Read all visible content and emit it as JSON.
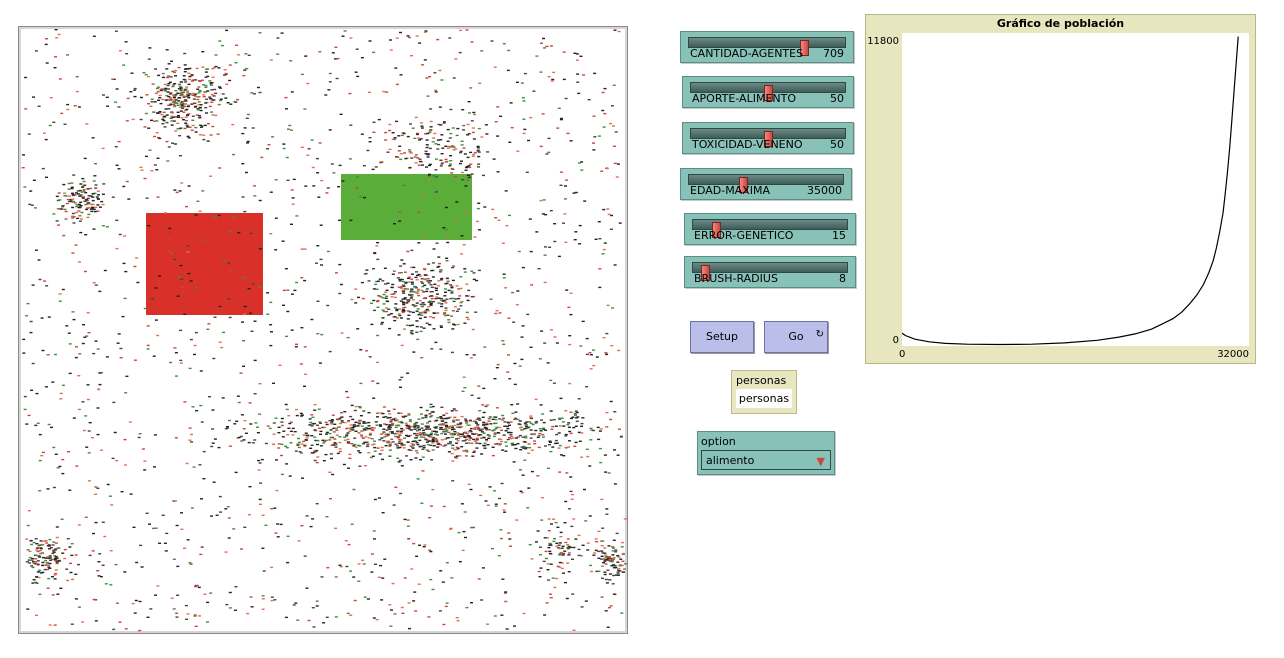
{
  "sliders": [
    {
      "label": "CANTIDAD-AGENTES",
      "value": "709",
      "fraction": 0.74
    },
    {
      "label": "APORTE-ALIMENTO",
      "value": "50",
      "fraction": 0.5
    },
    {
      "label": "TOXICIDAD-VENENO",
      "value": "50",
      "fraction": 0.5
    },
    {
      "label": "EDAD-MAXIMA",
      "value": "35000",
      "fraction": 0.35
    },
    {
      "label": "ERROR-GENETICO",
      "value": "15",
      "fraction": 0.15
    },
    {
      "label": "BRUSH-RADIUS",
      "value": "8",
      "fraction": 0.08
    }
  ],
  "buttons": {
    "setup": "Setup",
    "go": "Go",
    "go_forever_icon": "↻"
  },
  "monitor": {
    "label": "personas",
    "value": "personas"
  },
  "chooser": {
    "label": "option",
    "selected": "alimento",
    "arrow_icon": "▼"
  },
  "world": {
    "colors": {
      "food_patch": "#5aad38",
      "poison_patch": "#d9312a"
    },
    "agent_colors": [
      "#222222",
      "#222222",
      "#444444",
      "#c9473f",
      "#e07050",
      "#3f8f3f"
    ]
  },
  "chart_data": {
    "type": "line",
    "title": "Gráfico de población",
    "xlabel": "",
    "ylabel": "",
    "xlim": [
      0,
      32000
    ],
    "ylim": [
      0,
      11800
    ],
    "tick_labels": {
      "x_min": "0",
      "x_max": "32000",
      "y_min": "0",
      "y_max": "11800"
    },
    "series": [
      {
        "x": [
          0,
          300,
          1200,
          2500,
          4000,
          6000,
          9000,
          12000,
          15000,
          18000,
          20000,
          21500,
          23000,
          24000,
          25000,
          25800,
          26500,
          27200,
          27800,
          28300,
          28700,
          29000,
          29300,
          29600,
          29800,
          30000,
          30200,
          30400,
          30600,
          30800,
          31000
        ],
        "values": [
          450,
          360,
          220,
          120,
          60,
          30,
          20,
          30,
          80,
          180,
          300,
          420,
          600,
          800,
          1000,
          1250,
          1550,
          1900,
          2300,
          2750,
          3200,
          3700,
          4300,
          5000,
          5700,
          6500,
          7400,
          8400,
          9500,
          10600,
          11700
        ]
      }
    ]
  }
}
